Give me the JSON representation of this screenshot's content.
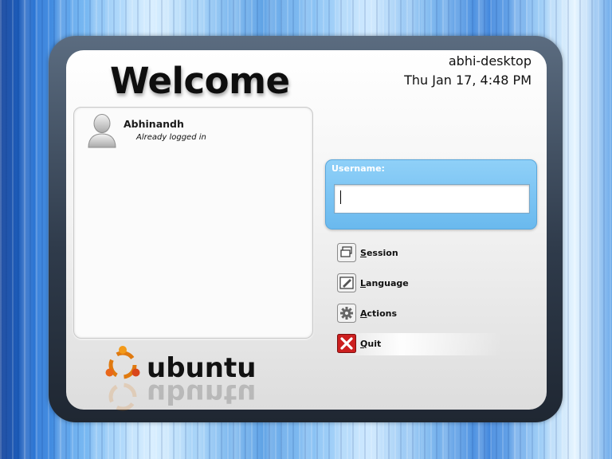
{
  "greeter": {
    "welcome_text": "Welcome",
    "hostname": "abhi-desktop",
    "datetime": "Thu Jan 17,  4:48 PM"
  },
  "users": [
    {
      "name": "Abhinandh",
      "status": "Already logged in",
      "icon": "user-avatar-icon"
    }
  ],
  "login": {
    "label": "Username:",
    "value": "",
    "placeholder": ""
  },
  "actions": [
    {
      "label": "Session",
      "icon": "session-icon"
    },
    {
      "label": "Language",
      "icon": "language-icon"
    },
    {
      "label": "Actions",
      "icon": "gear-icon"
    },
    {
      "label": "Quit",
      "icon": "quit-icon"
    }
  ],
  "branding": {
    "logo_text": "ubuntu",
    "logo_colors": [
      "#f08c00",
      "#d8461b",
      "#e37a16"
    ]
  },
  "colors": {
    "login_box": "#78c2f2",
    "quit_red": "#cc1f1f"
  }
}
